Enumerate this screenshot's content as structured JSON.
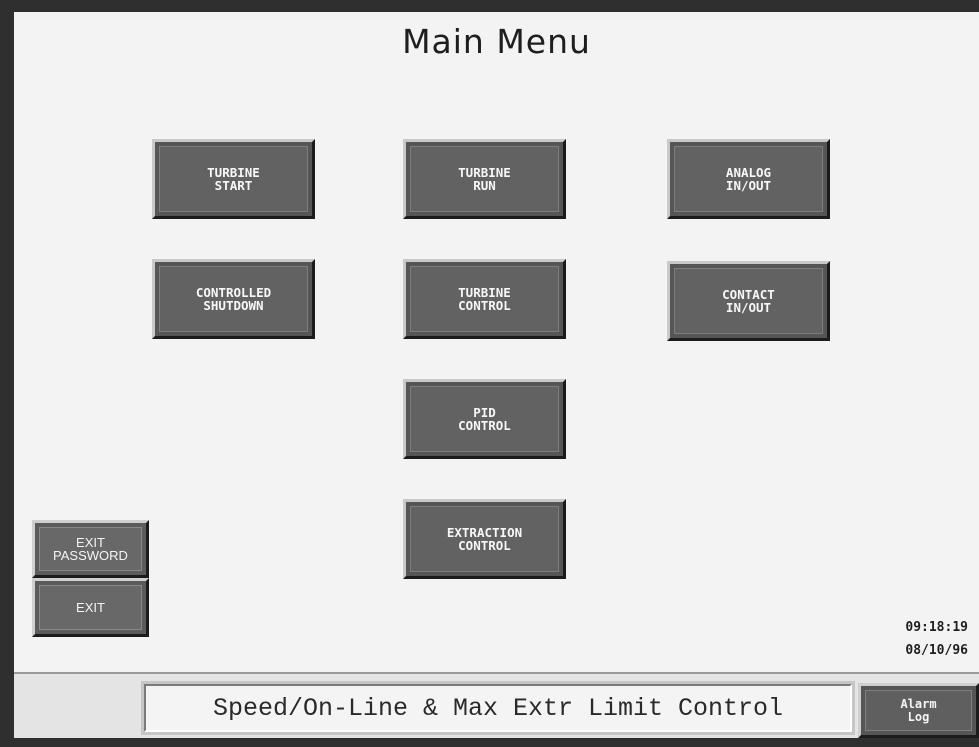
{
  "title": "Main Menu",
  "menu": {
    "turbine_start": "TURBINE\nSTART",
    "turbine_run": "TURBINE\nRUN",
    "analog_in_out": "ANALOG\nIN/OUT",
    "controlled_shutdown": "CONTROLLED\nSHUTDOWN",
    "turbine_control": "TURBINE\nCONTROL",
    "contact_in_out": "CONTACT\nIN/OUT",
    "pid_control": "PID\nCONTROL",
    "extraction_control": "EXTRACTION\nCONTROL"
  },
  "side_buttons": {
    "exit_password": "EXIT\nPASSWORD",
    "exit": "EXIT"
  },
  "clock": {
    "time": "09:18:19",
    "date": "08/10/96"
  },
  "status": {
    "message": "Speed/On-Line & Max Extr Limit Control",
    "alarm_log": "Alarm\nLog"
  }
}
